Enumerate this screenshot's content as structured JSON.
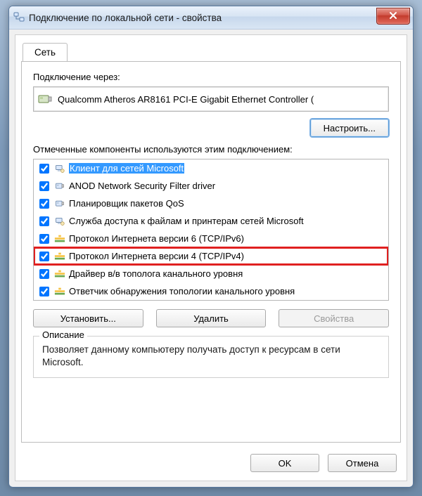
{
  "window": {
    "title": "Подключение по локальной сети - свойства"
  },
  "tab": {
    "network": "Сеть"
  },
  "adapter": {
    "label": "Подключение через:",
    "name": "Qualcomm Atheros AR8161 PCI-E Gigabit Ethernet Controller (",
    "configure": "Настроить..."
  },
  "components": {
    "label": "Отмеченные компоненты используются этим подключением:",
    "items": [
      {
        "label": "Клиент для сетей Microsoft",
        "icon": "client",
        "selected": true
      },
      {
        "label": "ANOD Network Security Filter driver",
        "icon": "nic",
        "selected": false
      },
      {
        "label": "Планировщик пакетов QoS",
        "icon": "nic",
        "selected": false
      },
      {
        "label": "Служба доступа к файлам и принтерам сетей Microsoft",
        "icon": "client",
        "selected": false
      },
      {
        "label": "Протокол Интернета версии 6 (TCP/IPv6)",
        "icon": "proto",
        "selected": false
      },
      {
        "label": "Протокол Интернета версии 4 (TCP/IPv4)",
        "icon": "proto",
        "selected": false,
        "highlighted": true
      },
      {
        "label": "Драйвер в/в тополога канального уровня",
        "icon": "proto",
        "selected": false
      },
      {
        "label": "Ответчик обнаружения топологии канального уровня",
        "icon": "proto",
        "selected": false
      }
    ]
  },
  "buttons": {
    "install": "Установить...",
    "uninstall": "Удалить",
    "properties": "Свойства",
    "ok": "OK",
    "cancel": "Отмена"
  },
  "description": {
    "legend": "Описание",
    "text": "Позволяет данному компьютеру получать доступ к ресурсам в сети Microsoft."
  }
}
